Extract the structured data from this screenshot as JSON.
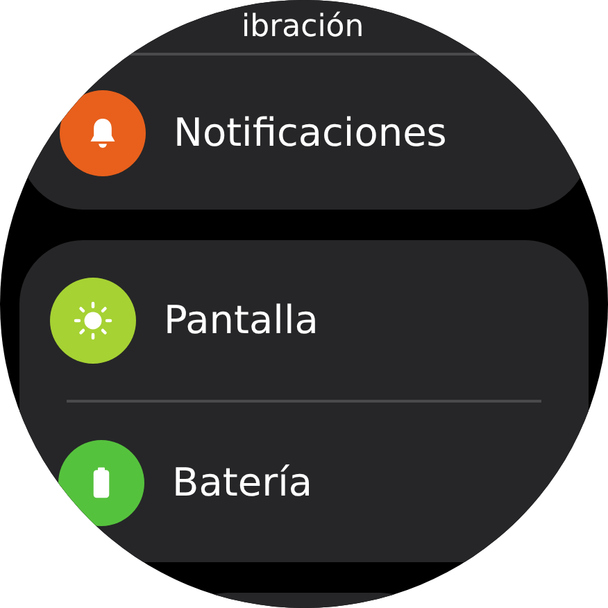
{
  "groups": [
    {
      "kind": "list",
      "items": [
        {
          "label": "ibración"
        },
        {
          "label": "Notificaciones",
          "kind": "bell",
          "color": "#e8601c"
        }
      ]
    },
    {
      "kind": "list",
      "items": [
        {
          "label": "Pantalla",
          "kind": "sun",
          "color": "#a6d233"
        },
        {
          "label": "Batería",
          "kind": "battery",
          "color": "#55c23d"
        }
      ]
    },
    {
      "kind": "stub"
    }
  ]
}
